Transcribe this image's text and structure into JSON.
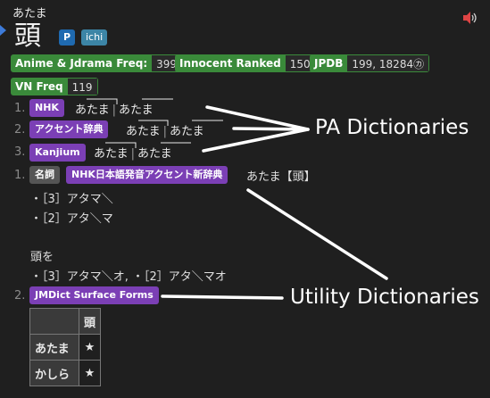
{
  "entry": {
    "reading": "あたま",
    "expression": "頭",
    "tags": [
      "P",
      "ichi"
    ]
  },
  "frequencies": [
    {
      "label": "Anime & Jdrama Freq:",
      "value": "399"
    },
    {
      "label": "Innocent Ranked",
      "value": "150"
    },
    {
      "label": "JPDB",
      "value": "199, 18284㋕"
    },
    {
      "label": "VN Freq",
      "value": "119"
    }
  ],
  "pitch_rows": [
    {
      "num": "1.",
      "dict": "NHK",
      "a": "あたま",
      "b": "あたま"
    },
    {
      "num": "2.",
      "dict": "アクセント辞典",
      "a": "あたま",
      "b": "あたま"
    },
    {
      "num": "3.",
      "dict": "Kanjium",
      "a": "あたま",
      "b": "あたま"
    }
  ],
  "definition": {
    "num": "1.",
    "pos": "名詞",
    "dict": "NHK日本語発音アクセント新辞典",
    "headword": "あたま【頭】",
    "lines": [
      "・［3］アタマ＼",
      "・［2］アタ＼マ"
    ],
    "sub_title": "頭を",
    "sub_line": "・［3］アタマ＼オ, ・［2］アタ＼マオ"
  },
  "surface": {
    "num": "2.",
    "dict": "JMDict Surface Forms",
    "header": [
      "",
      "頭"
    ],
    "rows": [
      [
        "あたま",
        "★"
      ],
      [
        "かしら",
        "★"
      ]
    ]
  },
  "annotations": {
    "pa": "PA Dictionaries",
    "utility": "Utility Dictionaries"
  },
  "colors": {
    "dict_purple": "#7b3fb5",
    "freq_green": "#3a8a3a",
    "tag_blue": "#1f6ab0"
  }
}
